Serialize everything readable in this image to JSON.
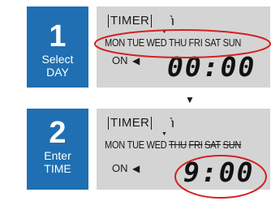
{
  "step1": {
    "number": "1",
    "line1": "Select",
    "line2": "DAY"
  },
  "step2": {
    "number": "2",
    "line1": "Enter",
    "line2": "TIME"
  },
  "panel1": {
    "timer": "TIMER",
    "days": [
      "MON",
      "TUE",
      "WED",
      "THU",
      "FRI",
      "SAT",
      "SUN"
    ],
    "on": "ON",
    "time": "00:00",
    "highlight_color": "#d42020"
  },
  "panel2": {
    "timer": "TIMER",
    "days": [
      "MON",
      "TUE",
      "WED",
      "THU",
      "FRI",
      "SAT",
      "SUN"
    ],
    "on": "ON",
    "time": "9:00",
    "highlight_color": "#d42020"
  },
  "colors": {
    "step_box": "#1f6fb2",
    "lcd_background": "#d4d4d4"
  },
  "icons": {
    "between_steps": "down-triangle-icon",
    "on_pointer": "left-triangle-icon",
    "selected_day_marker": "down-triangle-icon"
  }
}
